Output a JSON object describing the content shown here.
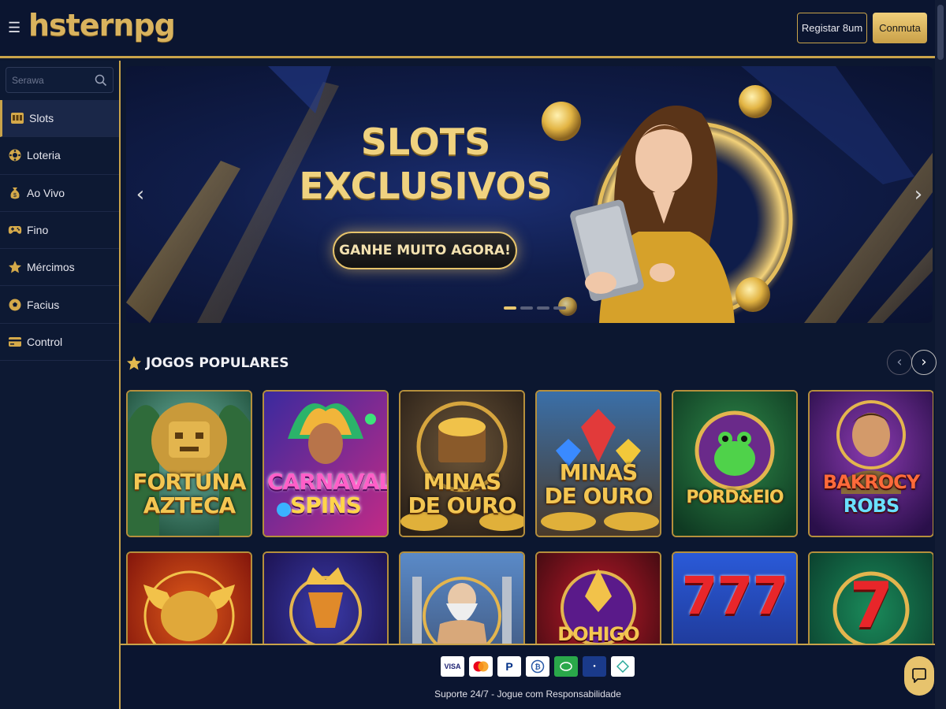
{
  "header": {
    "logo_text": "hsternpg",
    "register_label": "Registar 8um",
    "login_label": "Conmuta"
  },
  "sidebar": {
    "search_placeholder": "Serawa",
    "items": [
      {
        "label": "Slots",
        "icon": "slot-machine-icon"
      },
      {
        "label": "Loteria",
        "icon": "lottery-ball-icon"
      },
      {
        "label": "Ao Vivo",
        "icon": "money-bag-icon"
      },
      {
        "label": "Fino",
        "icon": "gamepad-icon"
      },
      {
        "label": "Mércimos",
        "icon": "star-icon"
      },
      {
        "label": "Facius",
        "icon": "soccer-ball-icon"
      },
      {
        "label": "Control",
        "icon": "card-icon"
      }
    ]
  },
  "banner": {
    "title_line1": "SLOTS",
    "title_line2": "EXCLUSIVOS",
    "cta_label": "GANHE MUITO AGORA!",
    "slide_count": 4,
    "active_slide": 1
  },
  "popular": {
    "title": "JOGOS POPULARES",
    "games": [
      {
        "line1": "FORTUNA",
        "line2": "AZTECA",
        "theme": "jungle"
      },
      {
        "line1": "CARNAVAL",
        "line2": "SPINS",
        "theme": "carnival"
      },
      {
        "line1": "MINAS",
        "line2": "DE OURO",
        "theme": "mine"
      },
      {
        "line1": "MINAS",
        "line2": "DE OURO",
        "theme": "gems"
      },
      {
        "line1": "PORD&EIO",
        "line2": "",
        "theme": "frog"
      },
      {
        "line1": "BAKROCY",
        "line2": "ROBS",
        "theme": "explorer"
      },
      {
        "line1": "",
        "line2": "",
        "theme": "bull"
      },
      {
        "line1": "",
        "line2": "",
        "theme": "crown"
      },
      {
        "line1": "",
        "line2": "",
        "theme": "zeus"
      },
      {
        "line1": "",
        "line2": "",
        "theme": "dragon",
        "partial_text": "DOHIGO"
      },
      {
        "line1": "",
        "line2": "",
        "theme": "777",
        "partial_text": "777"
      },
      {
        "line1": "",
        "line2": "",
        "theme": "seven",
        "partial_text": "7"
      }
    ]
  },
  "footer": {
    "payments": [
      "VISA",
      "Mastercard",
      "PayPal",
      "Bitcoin",
      "Skrill",
      "Paysafe",
      "Pix"
    ],
    "support_text": "Suporte 24/7 - Jogue com Responsabilidade"
  },
  "colors": {
    "gold": "#c9a34a",
    "navy": "#0b1530",
    "button_gold": "#e7c36d"
  }
}
